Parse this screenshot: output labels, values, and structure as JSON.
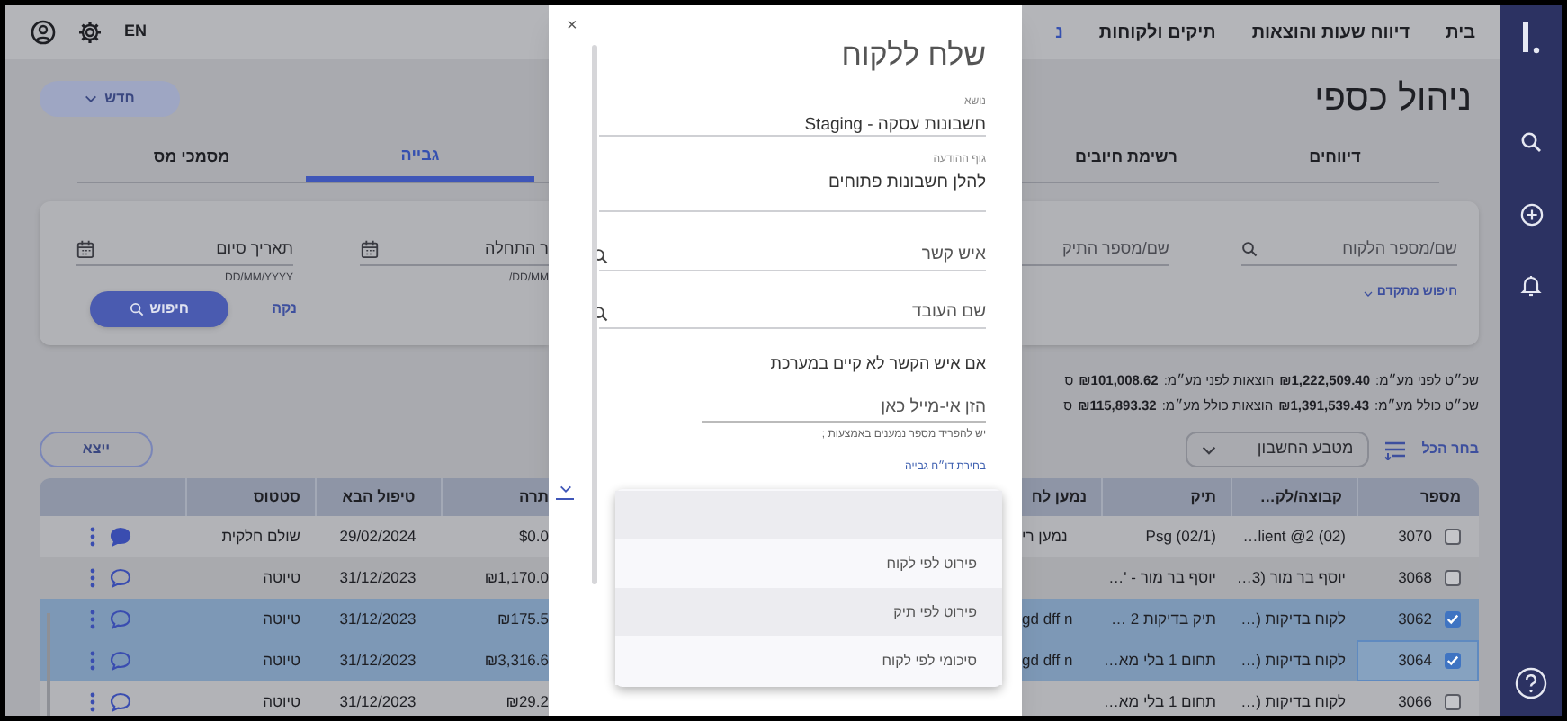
{
  "top_nav": {
    "items": [
      {
        "label": "בית",
        "selected": false
      },
      {
        "label": "דיווח שעות והוצאות",
        "selected": false
      },
      {
        "label": "תיקים ולקוחות",
        "selected": false
      },
      {
        "label": "נ",
        "selected": true
      }
    ],
    "language": "EN"
  },
  "page": {
    "title": "ניהול כספי",
    "new_button": "חדש"
  },
  "tabs": [
    {
      "label": "דיווחים",
      "selected": false
    },
    {
      "label": "רשימת חיובים",
      "selected": false
    },
    {
      "label": "גבייה",
      "selected": true
    },
    {
      "label": "מסמכי מס",
      "selected": false
    }
  ],
  "search": {
    "client_placeholder": "שם/מספר הלקוח",
    "file_placeholder": "שם/מספר התיק",
    "advanced": "חיפוש מתקדם",
    "start_date_label": "ר התחלה",
    "start_date_hint": "DD/MM/",
    "end_date_label": "תאריך סיום",
    "end_date_hint": "DD/MM/YYYY",
    "clear": "נקה",
    "search_button": "חיפוש"
  },
  "summary": [
    {
      "items": [
        {
          "label": "שכ״ט לפני מע״מ:",
          "amount": "₪1,222,509.40"
        },
        {
          "label": "הוצאות לפני מע״מ:",
          "amount": "₪101,008.62"
        },
        {
          "label": "ס"
        }
      ]
    },
    {
      "items": [
        {
          "label": "שכ״ט כולל מע״מ:",
          "amount": "₪1,391,539.43"
        },
        {
          "label": "הוצאות כולל מע״מ:",
          "amount": "₪115,893.32"
        },
        {
          "label": "ס"
        }
      ]
    }
  ],
  "toolbar": {
    "select_all": "בחר הכל",
    "currency_placeholder": "מטבע החשבון",
    "export_button": "ייצא"
  },
  "table": {
    "columns": [
      "מספר",
      "קבוצה/לק…",
      "תיק",
      "נמען לח",
      "תרה",
      "טיפול הבא",
      "סטטוס"
    ],
    "rows": [
      {
        "checked": false,
        "focused": false,
        "number": "3070",
        "group": "…lient @2 (02)",
        "file": "Psg (02/1)",
        "recipient": "נמען רי",
        "balance": "$0.0",
        "next_treatment": "29/02/2024",
        "status": "שולם חלקית",
        "comment_filled": true
      },
      {
        "checked": false,
        "focused": false,
        "number": "3068",
        "group": "יוסף בר מור (3…",
        "file": "יוסף בר מור - '…",
        "balance": "₪1,170.0",
        "next_treatment": "31/12/2023",
        "status": "טיוטה",
        "comment_filled": false
      },
      {
        "checked": true,
        "focused": false,
        "number": "3062",
        "group": "לקוח בדיקות (…",
        "file": "תיק בדיקות 2 …",
        "recipient": "gd dff n",
        "balance": "₪175.5",
        "next_treatment": "31/12/2023",
        "status": "טיוטה",
        "comment_filled": false
      },
      {
        "checked": true,
        "focused": true,
        "number": "3064",
        "group": "לקוח בדיקות (…",
        "file": "תחום 1 בלי מא…",
        "recipient": "gd dff n",
        "balance": "₪3,316.6",
        "next_treatment": "31/12/2023",
        "status": "טיוטה",
        "comment_filled": false
      },
      {
        "checked": false,
        "focused": false,
        "number": "3066",
        "group": "לקוח בדיקות (…",
        "file": "תחום 1 בלי מא…",
        "balance": "₪29.2",
        "next_treatment": "31/12/2023",
        "status": "טיוטה",
        "comment_filled": false
      }
    ]
  },
  "modal": {
    "close": "×",
    "title": "שלח ללקוח",
    "subject": {
      "label": "נושא",
      "value": "חשבונות עסקה - Staging"
    },
    "body": {
      "label": "גוף ההודעה",
      "value": "להלן חשבונות פתוחים"
    },
    "contact": {
      "placeholder": "איש קשר"
    },
    "employee": {
      "placeholder": "שם העובד"
    },
    "note": "אם איש הקשר לא קיים במערכת",
    "email": {
      "placeholder": "הזן אי-מייל כאן",
      "hint": "יש להפריד מספר נמענים באמצעות ;"
    },
    "report_label": "בחירת דו״ח גבייה",
    "report_options": [
      {
        "kind": "blank",
        "highlighted": true
      },
      {
        "kind": "option",
        "label": "פירוט לפי לקוח",
        "highlighted": false
      },
      {
        "kind": "option",
        "label": "פירוט לפי תיק",
        "highlighted": true
      },
      {
        "kind": "option",
        "label": "סיכומי לפי לקוח",
        "highlighted": false
      }
    ]
  }
}
